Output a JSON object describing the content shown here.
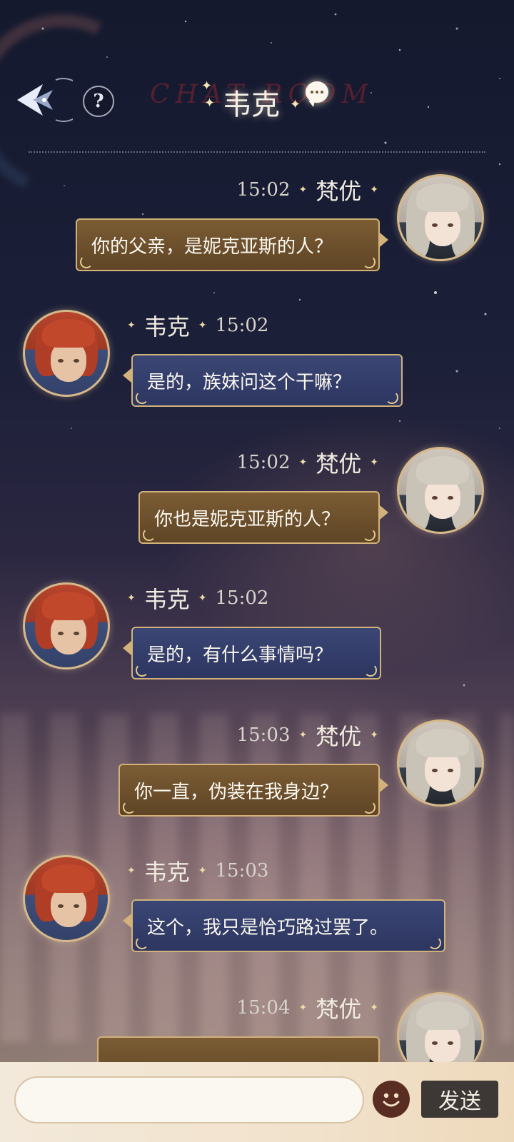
{
  "header": {
    "title": "韦克",
    "chatroom_watermark": "CHAT ROOM",
    "help_label": "?"
  },
  "messages": [
    {
      "sender": "梵优",
      "side": "right",
      "time": "15:02",
      "text": "你的父亲，是妮克亚斯的人？",
      "bubble": "gold"
    },
    {
      "sender": "韦克",
      "side": "left",
      "time": "15:02",
      "text": "是的，族妹问这个干嘛？",
      "bubble": "blue"
    },
    {
      "sender": "梵优",
      "side": "right",
      "time": "15:02",
      "text": "你也是妮克亚斯的人？",
      "bubble": "gold"
    },
    {
      "sender": "韦克",
      "side": "left",
      "time": "15:02",
      "text": "是的，有什么事情吗？",
      "bubble": "blue"
    },
    {
      "sender": "梵优",
      "side": "right",
      "time": "15:03",
      "text": "你一直，伪装在我身边？",
      "bubble": "gold"
    },
    {
      "sender": "韦克",
      "side": "left",
      "time": "15:03",
      "text": "这个，我只是恰巧路过罢了。",
      "bubble": "blue"
    },
    {
      "sender": "梵优",
      "side": "right",
      "time": "15:04",
      "text": "",
      "bubble": "gold"
    }
  ],
  "input": {
    "placeholder": "",
    "send_label": "发送"
  },
  "icons": {
    "back": "back-arrow-icon",
    "help": "help-icon",
    "chat": "chat-bubble-icon",
    "emoji": "emoji-icon"
  }
}
